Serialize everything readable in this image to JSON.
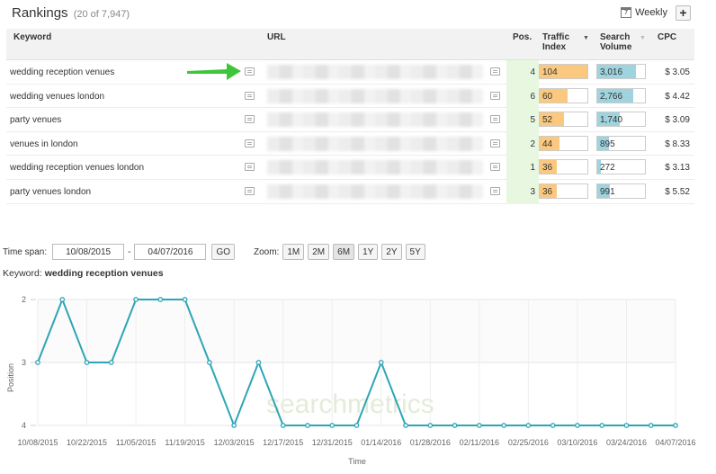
{
  "header": {
    "title": "Rankings",
    "count": "(20 of 7,947)",
    "calendar_icon_text": "7",
    "weekly_label": "Weekly",
    "add_label": "+"
  },
  "table": {
    "columns": {
      "keyword": "Keyword",
      "url": "URL",
      "pos": "Pos.",
      "traffic_index": [
        "Traffic",
        "Index"
      ],
      "search_volume": [
        "Search",
        "Volume"
      ],
      "cpc": "CPC"
    },
    "rows": [
      {
        "keyword": "wedding reception venues",
        "pos": "4",
        "traffic": "104",
        "traffic_fill": 1.0,
        "volume": "3,016",
        "volume_fill": 0.82,
        "cpc": "$ 3.05"
      },
      {
        "keyword": "wedding venues london",
        "pos": "6",
        "traffic": "60",
        "traffic_fill": 0.58,
        "volume": "2,766",
        "volume_fill": 0.75,
        "cpc": "$ 4.42"
      },
      {
        "keyword": "party venues",
        "pos": "5",
        "traffic": "52",
        "traffic_fill": 0.5,
        "volume": "1,740",
        "volume_fill": 0.47,
        "cpc": "$ 3.09"
      },
      {
        "keyword": "venues in london",
        "pos": "2",
        "traffic": "44",
        "traffic_fill": 0.42,
        "volume": "895",
        "volume_fill": 0.25,
        "cpc": "$ 8.33"
      },
      {
        "keyword": "wedding reception venues london",
        "pos": "1",
        "traffic": "36",
        "traffic_fill": 0.35,
        "volume": "272",
        "volume_fill": 0.08,
        "cpc": "$ 3.13"
      },
      {
        "keyword": "party venues london",
        "pos": "3",
        "traffic": "36",
        "traffic_fill": 0.35,
        "volume": "991",
        "volume_fill": 0.27,
        "cpc": "$ 5.52"
      }
    ]
  },
  "controls": {
    "timespan_label": "Time span:",
    "from_date": "10/08/2015",
    "separator": "-",
    "to_date": "04/07/2016",
    "go_label": "GO",
    "zoom_label": "Zoom:",
    "zoom_options": [
      "1M",
      "2M",
      "6M",
      "1Y",
      "2Y",
      "5Y"
    ],
    "zoom_selected": "6M"
  },
  "keyword_line": {
    "label": "Keyword:",
    "value": "wedding reception venues"
  },
  "watermark": "searchmetrics",
  "colors": {
    "traffic_bar": "#fbc87f",
    "volume_bar": "#9fd4df",
    "pos_highlight": "#e8f7e0",
    "line": "#2ea5b5",
    "arrow": "#3ec63a"
  },
  "chart_data": {
    "type": "line",
    "title": "",
    "xlabel": "Time",
    "ylabel": "Position",
    "ylim": [
      4,
      2
    ],
    "y_reversed": true,
    "yticks": [
      "2",
      "3",
      "4"
    ],
    "x_tick_labels": [
      "10/08/2015",
      "10/22/2015",
      "11/05/2015",
      "11/19/2015",
      "12/03/2015",
      "12/17/2015",
      "12/31/2015",
      "01/14/2016",
      "01/28/2016",
      "02/11/2016",
      "02/25/2016",
      "03/10/2016",
      "03/24/2016",
      "04/07/2016"
    ],
    "series": [
      {
        "x": [
          "10/08/2015",
          "10/15/2015",
          "10/22/2015",
          "10/29/2015",
          "11/05/2015",
          "11/12/2015",
          "11/19/2015",
          "11/26/2015",
          "12/03/2015",
          "12/10/2015",
          "12/17/2015",
          "12/24/2015",
          "12/31/2015",
          "01/07/2016",
          "01/14/2016",
          "01/21/2016",
          "01/28/2016",
          "02/04/2016",
          "02/11/2016",
          "02/18/2016",
          "02/25/2016",
          "03/03/2016",
          "03/10/2016",
          "03/17/2016",
          "03/24/2016",
          "03/31/2016",
          "04/07/2016"
        ],
        "values": [
          3,
          2,
          3,
          3,
          2,
          2,
          2,
          3,
          4,
          3,
          4,
          4,
          4,
          4,
          3,
          4,
          4,
          4,
          4,
          4,
          4,
          4,
          4,
          4,
          4,
          4,
          4
        ]
      }
    ]
  }
}
